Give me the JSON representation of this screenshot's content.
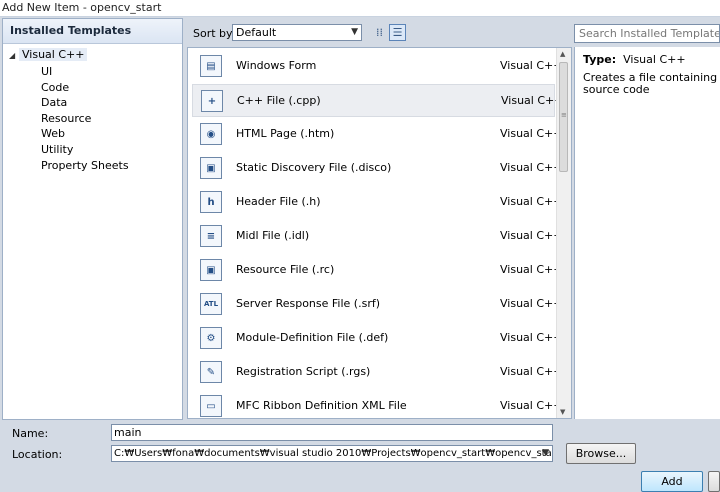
{
  "window": {
    "title": "Add New Item - opencv_start"
  },
  "left_panel": {
    "header": "Installed Templates",
    "root": {
      "label": "Visual C++",
      "expanded": true
    },
    "children": [
      "UI",
      "Code",
      "Data",
      "Resource",
      "Web",
      "Utility",
      "Property Sheets"
    ]
  },
  "toolbar": {
    "sort_label": "Sort by:",
    "sort_value": "Default",
    "search_placeholder": "Search Installed Templates"
  },
  "templates": [
    {
      "name": "Windows Form",
      "type": "Visual C++",
      "icon": "form-icon",
      "glyph": "▤"
    },
    {
      "name": "C++ File (.cpp)",
      "type": "Visual C++",
      "icon": "cpp-file-icon",
      "glyph": "+",
      "selected": true
    },
    {
      "name": "HTML Page (.htm)",
      "type": "Visual C++",
      "icon": "html-page-icon",
      "glyph": "◉"
    },
    {
      "name": "Static Discovery File (.disco)",
      "type": "Visual C++",
      "icon": "disco-file-icon",
      "glyph": "▣"
    },
    {
      "name": "Header File (.h)",
      "type": "Visual C++",
      "icon": "header-file-icon",
      "glyph": "h"
    },
    {
      "name": "Midl File (.idl)",
      "type": "Visual C++",
      "icon": "idl-file-icon",
      "glyph": "≡"
    },
    {
      "name": "Resource File (.rc)",
      "type": "Visual C++",
      "icon": "resource-file-icon",
      "glyph": "▣"
    },
    {
      "name": "Server Response File (.srf)",
      "type": "Visual C++",
      "icon": "srf-file-icon",
      "glyph": "ATL"
    },
    {
      "name": "Module-Definition File (.def)",
      "type": "Visual C++",
      "icon": "def-file-icon",
      "glyph": "⚙"
    },
    {
      "name": "Registration Script (.rgs)",
      "type": "Visual C++",
      "icon": "rgs-file-icon",
      "glyph": "✎"
    },
    {
      "name": "MFC Ribbon Definition XML File",
      "type": "Visual C++",
      "icon": "ribbon-xml-icon",
      "glyph": "▭"
    }
  ],
  "description": {
    "type_label": "Type:",
    "type_value": "Visual C++",
    "text": "Creates a file containing C++ source code"
  },
  "form": {
    "name_label": "Name:",
    "name_value": "main",
    "location_label": "Location:",
    "location_value": "C:₩Users₩fona₩documents₩visual studio 2010₩Projects₩opencv_start₩opencv_start₩",
    "browse_label": "Browse...",
    "add_label": "Add"
  }
}
